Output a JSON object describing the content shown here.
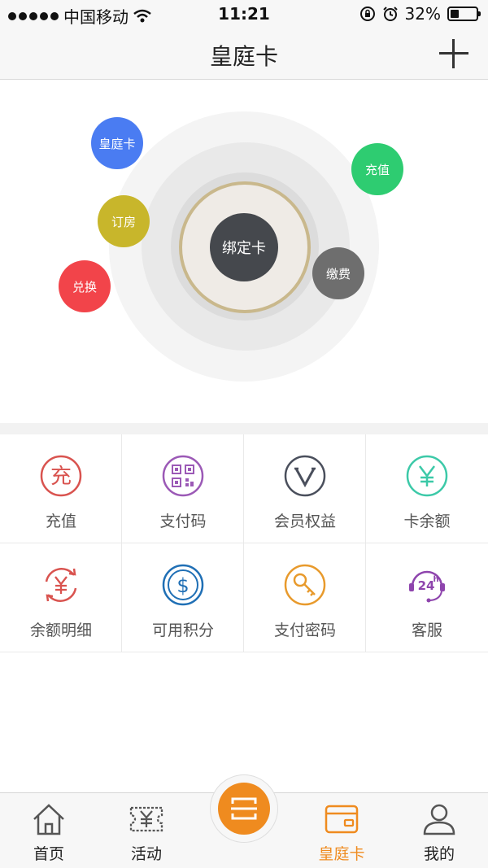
{
  "status_bar": {
    "carrier": "中国移动",
    "time": "11:21",
    "battery": "32%",
    "battery_level": 0.32
  },
  "nav": {
    "title": "皇庭卡",
    "right_icon": "plus-icon"
  },
  "hero": {
    "center_label": "绑定卡",
    "bubbles": [
      {
        "label": "皇庭卡",
        "color": "#4a7cf2"
      },
      {
        "label": "充值",
        "color": "#2ecc71"
      },
      {
        "label": "订房",
        "color": "#c8b62b"
      },
      {
        "label": "缴费",
        "color": "#6e6e6e"
      },
      {
        "label": "兑换",
        "color": "#f2444a"
      }
    ]
  },
  "grid": [
    {
      "label": "充值",
      "icon": "recharge-icon",
      "color": "#d9534f"
    },
    {
      "label": "支付码",
      "icon": "qr-code-icon",
      "color": "#9b59b6"
    },
    {
      "label": "会员权益",
      "icon": "vip-icon",
      "color": "#4a4f5c"
    },
    {
      "label": "卡余额",
      "icon": "yen-icon",
      "color": "#3cc9a8"
    },
    {
      "label": "余额明细",
      "icon": "balance-detail-icon",
      "color": "#d9534f"
    },
    {
      "label": "可用积分",
      "icon": "dollar-icon",
      "color": "#1f6fb5"
    },
    {
      "label": "支付密码",
      "icon": "key-icon",
      "color": "#e89a2c"
    },
    {
      "label": "客服",
      "icon": "support-24h-icon",
      "color": "#8e44ad"
    }
  ],
  "tabs": [
    {
      "label": "首页",
      "icon": "home-icon",
      "active": false
    },
    {
      "label": "活动",
      "icon": "ticket-icon",
      "active": false
    },
    {
      "label": "皇庭卡",
      "icon": "card-wallet-icon",
      "active": true
    },
    {
      "label": "我的",
      "icon": "user-icon",
      "active": false
    }
  ],
  "colors": {
    "accent": "#ef8b1f",
    "tab_inactive": "#222222"
  }
}
